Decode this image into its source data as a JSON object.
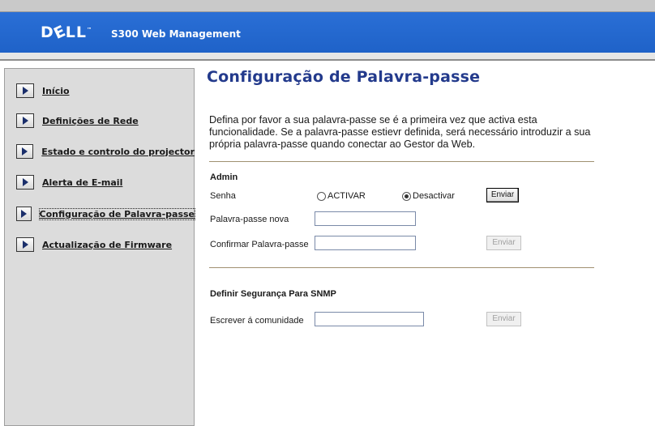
{
  "header": {
    "logo": "DELL",
    "title": "S300 Web Management"
  },
  "sidebar": {
    "items": [
      {
        "label": "Início"
      },
      {
        "label": "Definições de Rede"
      },
      {
        "label": "Estado e controlo do projector"
      },
      {
        "label": "Alerta de E-mail"
      },
      {
        "label": "Configuração de Palavra-passe",
        "active": true
      },
      {
        "label": "Actualização de Firmware"
      }
    ]
  },
  "page": {
    "title": "Configuração de Palavra-passe",
    "description": "Defina por favor a sua palavra-passe se é a primeira vez que activa esta funcionalidade. Se a palavra-passe estievr definida, será necessário introduzir a sua própria palavra-passe quando conectar ao Gestor da Web."
  },
  "admin": {
    "section_title": "Admin",
    "senha_label": "Senha",
    "radio_activar": "ACTIVAR",
    "radio_desactivar": "Desactivar",
    "selected": "Desactivar",
    "enviar_label": "Enviar",
    "new_password_label": "Palavra-passe nova",
    "new_password_value": "",
    "confirm_password_label": "Confirmar Palavra-passe",
    "confirm_password_value": "",
    "enviar_disabled_label": "Enviar"
  },
  "snmp": {
    "section_title": "Definir Segurança Para SNMP",
    "community_label": "Escrever á comunidade",
    "community_value": "",
    "enviar_label": "Enviar"
  },
  "colors": {
    "header_blue": "#2a6fd6",
    "title_blue": "#233a8c",
    "sidebar_gray": "#dcdcdc"
  }
}
